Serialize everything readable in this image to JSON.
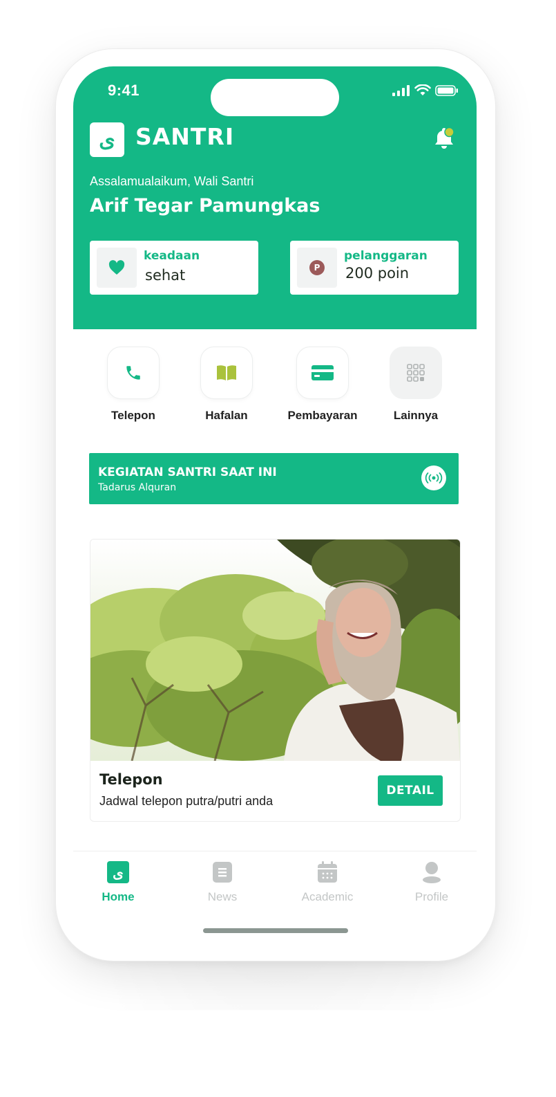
{
  "status_bar": {
    "time": "9:41"
  },
  "header": {
    "logo_glyph": "ى",
    "app_title": "SANTRI",
    "greeting": "Assalamualaikum, Wali Santri",
    "user_name": "Arif Tegar Pamungkas",
    "notification_dot_color": "#c6cc3a"
  },
  "stats": [
    {
      "label": "keadaan",
      "value": "sehat",
      "icon": "heart-icon"
    },
    {
      "label": "pelanggaran",
      "value": "200 poin",
      "icon": "points-icon",
      "icon_glyph": "P"
    }
  ],
  "quick_actions": [
    {
      "label": "Telepon",
      "icon": "phone-icon"
    },
    {
      "label": "Hafalan",
      "icon": "book-icon"
    },
    {
      "label": "Pembayaran",
      "icon": "card-icon"
    },
    {
      "label": "Lainnya",
      "icon": "grid-icon"
    }
  ],
  "current_activity": {
    "title": "KEGIATAN SANTRI SAAT INI",
    "subtitle": "Tadarus Alquran",
    "icon": "live-broadcast-icon"
  },
  "feature_card": {
    "title": "Telepon",
    "subtitle": "Jadwal telepon putra/putri anda",
    "button": "DETAIL"
  },
  "tab_bar": [
    {
      "label": "Home",
      "icon": "home-logo-icon",
      "active": true
    },
    {
      "label": "News",
      "icon": "news-icon",
      "active": false
    },
    {
      "label": "Academic",
      "icon": "calendar-icon",
      "active": false
    },
    {
      "label": "Profile",
      "icon": "profile-icon",
      "active": false
    }
  ],
  "colors": {
    "primary": "#14b886",
    "accent_yellow": "#c6cc3a",
    "book_green": "#aac23c",
    "points_brown": "#9c5a5a",
    "inactive": "#c3c6c6"
  }
}
